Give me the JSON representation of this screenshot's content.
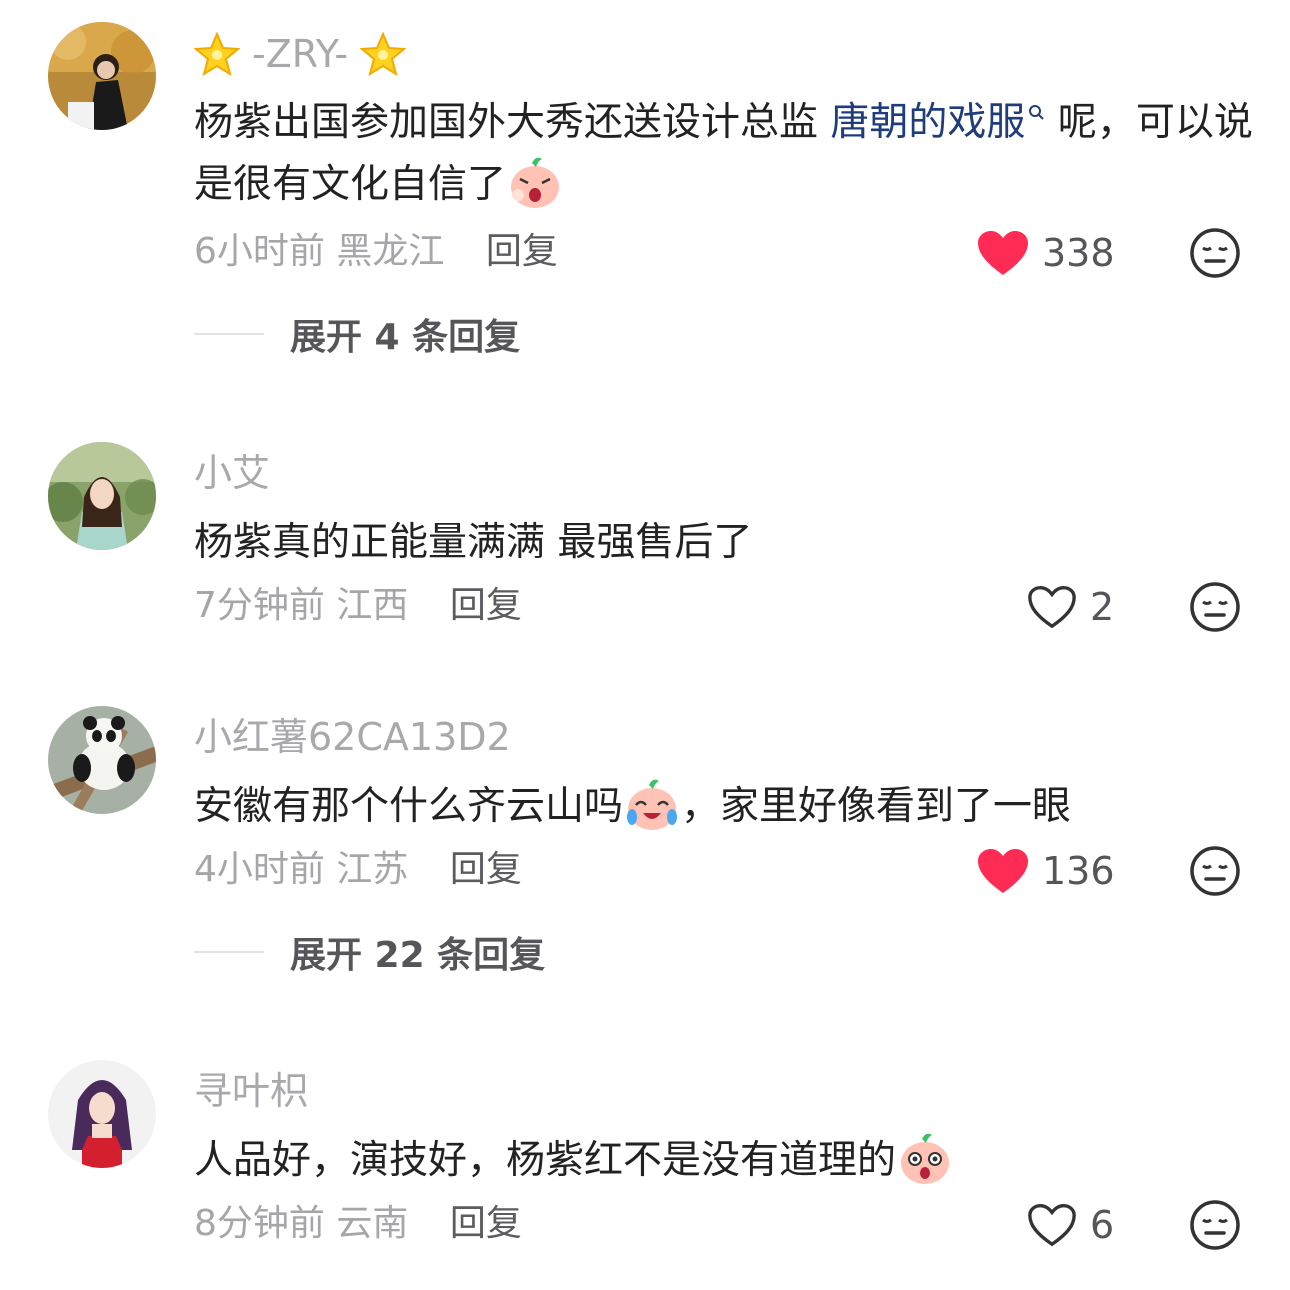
{
  "comments": [
    {
      "username": "-ZRY-",
      "text_before": "杨紫出国参加国外大秀还送设计总监 ",
      "link": "唐朝的戏服",
      "text_after": " 呢，可以说是很有文化自信了",
      "emoji": "shouting-peach-emoji",
      "time": "6小时前",
      "location": "黑龙江",
      "reply": "回复",
      "likes": "338",
      "liked": true,
      "expand": "展开 4 条回复"
    },
    {
      "username": "小艾",
      "text": "杨紫真的正能量满满 最强售后了",
      "time": "7分钟前",
      "location": "江西",
      "reply": "回复",
      "likes": "2",
      "liked": false
    },
    {
      "username": "小红薯62CA13D2",
      "text_before": "安徽有那个什么齐云山吗",
      "emoji": "crying-laughing-peach-emoji",
      "text_after": "，家里好像看到了一眼",
      "time": "4小时前",
      "location": "江苏",
      "reply": "回复",
      "likes": "136",
      "liked": true,
      "expand": "展开 22 条回复"
    },
    {
      "username": "寻叶枳",
      "text_before": "人品好，演技好，杨紫红不是没有道理的",
      "emoji": "shocked-peach-emoji",
      "time": "8分钟前",
      "location": "云南",
      "reply": "回复",
      "likes": "6",
      "liked": false
    }
  ],
  "colors": {
    "liked": "#fe2c55",
    "link": "#1f3d7a",
    "meta": "#a6a6aa"
  }
}
